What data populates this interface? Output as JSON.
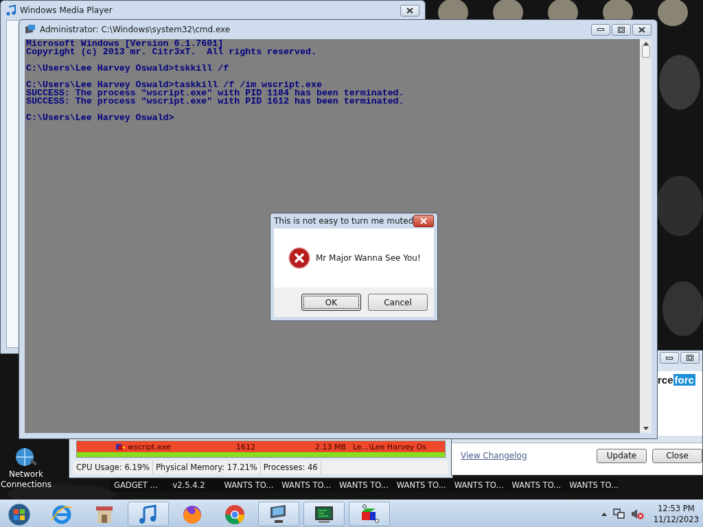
{
  "media_player_window": {
    "title": "Windows Media Player"
  },
  "console_window": {
    "title": "Administrator: C:\\Windows\\system32\\cmd.exe",
    "blocks": [
      [
        "Microsoft Windows [Version 6.1.7601]",
        "Copyright (c) 2013 mr. Citr3xT.  All rights reserved."
      ],
      [
        "C:\\Users\\Lee Harvey Oswald>tskkill /f"
      ],
      [
        "C:\\Users\\Lee Harvey Oswald>taskkill /f /im wscript.exe",
        "SUCCESS: The process \"wscript.exe\" with PID 1184 has been terminated.",
        "SUCCESS: The process \"wscript.exe\" with PID 1612 has been terminated."
      ],
      [
        "C:\\Users\\Lee Harvey Oswald>"
      ]
    ]
  },
  "task_manager_window": {
    "rows": [
      {
        "cells": [
          "wscript.exe",
          "1612",
          "2.13 MB",
          "Le...\\Lee Harvey Os"
        ],
        "color": "#f0482a"
      },
      {
        "color": "#86e01e"
      }
    ],
    "status_bar": [
      "CPU Usage: 6.19%",
      "Physical Memory: 17.21%",
      "Processes: 46"
    ]
  },
  "updater_window": {
    "logo_dark": "rce",
    "logo_light": "forc",
    "link": "View Changelog",
    "buttons": [
      "Update",
      "Close"
    ]
  },
  "message_dialog": {
    "title": "This is not easy to turn me muted",
    "message": "Mr Major Wanna See You!",
    "buttons": [
      {
        "label": "OK",
        "default": true
      },
      {
        "label": "Cancel",
        "default": false
      }
    ]
  },
  "desktop": {
    "icons": [
      {
        "label": "Network Connections"
      }
    ],
    "gadget_labels": [
      "GADGET ...",
      "v2.5.4.2",
      "WANTS TO...",
      "WANTS TO...",
      "WANTS TO...",
      "WANTS TO...",
      "WANTS TO...",
      "WANTS TO...",
      "WANTS TO..."
    ]
  },
  "taskbar": {
    "buttons": [
      {
        "kind": "start",
        "running": false
      },
      {
        "kind": "browser",
        "running": false
      },
      {
        "kind": "store",
        "running": false
      },
      {
        "kind": "music",
        "running": true
      },
      {
        "kind": "fox",
        "running": false
      },
      {
        "kind": "chrome",
        "running": false
      },
      {
        "kind": "monitor",
        "running": true
      },
      {
        "kind": "terminal",
        "running": true
      },
      {
        "kind": "cube",
        "running": true
      }
    ],
    "tray": {
      "volume_muted": true,
      "time": "12:53 PM",
      "date": "11/12/2023"
    }
  }
}
